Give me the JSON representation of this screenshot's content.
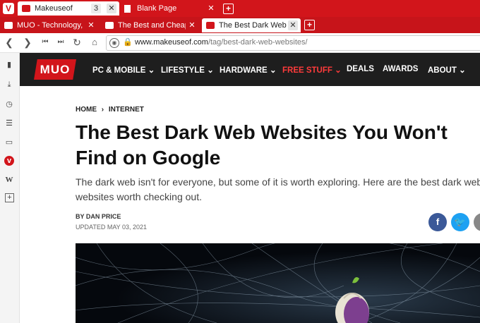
{
  "browser": {
    "logo": "V",
    "top_tabs": [
      {
        "label": "Makeuseof",
        "count": "3"
      },
      {
        "label": "Blank Page"
      }
    ],
    "stacked_tabs": [
      {
        "label": "MUO - Technology, Simplified"
      },
      {
        "label": "The Best and Cheapest"
      },
      {
        "label": "The Best Dark Web Websites"
      }
    ],
    "url_domain": "www.makeuseof.com",
    "url_path": "/tag/best-dark-web-websites/"
  },
  "site": {
    "logo": "MUO",
    "nav": [
      {
        "label": "PC & MOBILE"
      },
      {
        "label": "LIFESTYLE"
      },
      {
        "label": "HARDWARE"
      },
      {
        "label": "FREE STUFF"
      },
      {
        "label": "DEALS"
      },
      {
        "label": "AWARDS"
      },
      {
        "label": "ABOUT"
      }
    ]
  },
  "article": {
    "breadcrumb_home": "HOME",
    "breadcrumb_section": "INTERNET",
    "title_line1": "The Best Dark Web Websites You Won't",
    "title_line2": "Find on Google",
    "subtitle_line1": "The dark web isn't for everyone, but some of it is worth exploring. Here are the best dark web",
    "subtitle_line2": "websites worth checking out.",
    "byline": "BY DAN PRICE",
    "updated": "UPDATED MAY 03, 2021"
  },
  "colors": {
    "brand_red": "#d2151b",
    "header_dark": "#1e1e1e",
    "facebook": "#3b5998",
    "twitter": "#1da1f2"
  }
}
